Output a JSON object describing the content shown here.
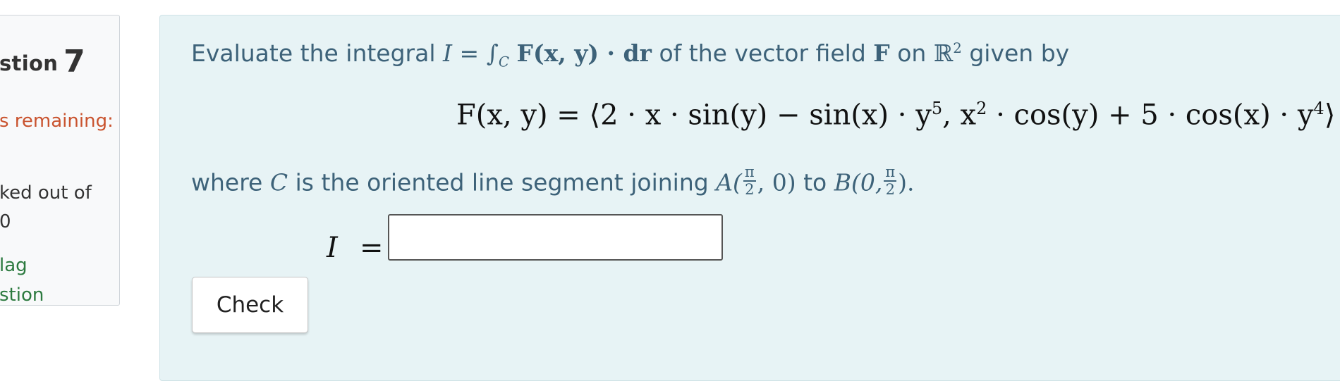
{
  "info": {
    "question_label": "stion",
    "question_number": "7",
    "remaining": "s remaining:",
    "marked_line1": "ked out of",
    "marked_line2": "0",
    "flag_line1": "lag",
    "flag_line2": "stion"
  },
  "question": {
    "intro_text": "Evaluate the integral",
    "integral_expr": "I = ∫",
    "integral_sub": "C",
    "integral_body": "F(x, y) · dr",
    "of_text": "of the vector field",
    "field_symbol": "F",
    "on_text": "on",
    "space_symbol": "ℝ",
    "space_power": "2",
    "given_text": "given by",
    "formula_lhs": "F(x, y) = ⟨2 · x · sin(y) − sin(x) · y",
    "formula_pow1": "5",
    "formula_mid": ", x",
    "formula_pow2": "2",
    "formula_mid2": " · cos(y) + 5 · cos(x) · y",
    "formula_pow3": "4",
    "formula_end": "⟩",
    "where_text": "where",
    "curve_symbol": "C",
    "segment_text": "is  the oriented line segment joining",
    "point_a_prefix": "A(",
    "frac_num": "π",
    "frac_den": "2",
    "point_a_suffix": ", 0)",
    "to_text": "to",
    "point_b_prefix": "B(0,",
    "point_b_suffix": ").",
    "answer_label": "I",
    "equals": "=",
    "answer_value": "",
    "check_label": "Check"
  }
}
